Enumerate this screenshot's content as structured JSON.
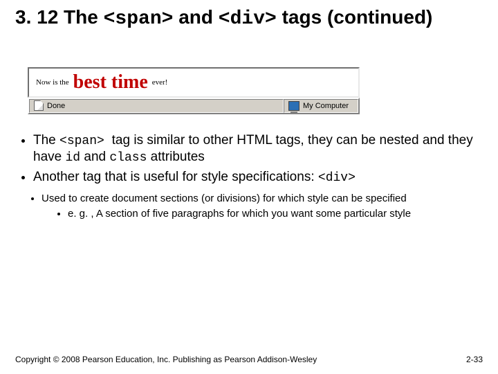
{
  "title": {
    "part1": "3. 12 The ",
    "tag1": "<span>",
    "part2": " and ",
    "tag2": "<div>",
    "part3": " tags ",
    "suffix": "(continued)"
  },
  "browser": {
    "prefix": "Now is the ",
    "highlight": "best time",
    "suffix": " ever!",
    "status_done": "Done",
    "status_zone": "My Computer"
  },
  "bullets": {
    "b1_pre": "The ",
    "b1_span": "<span> ",
    "b1_mid": "tag is similar to other HTML tags, they can be nested and they have ",
    "b1_id": "id",
    "b1_and": " and ",
    "b1_class": "class",
    "b1_post": " attributes",
    "b2_pre": "Another tag that is useful for style specifications: ",
    "b2_div": "<div>",
    "b3": "Used to create document sections (or divisions) for which style can be specified",
    "b4": "e. g. , A section of five paragraphs for which you want some particular style"
  },
  "footer": {
    "copyright": "Copyright © 2008 Pearson Education, Inc. Publishing as Pearson Addison-Wesley",
    "pagenum": "2-33"
  }
}
